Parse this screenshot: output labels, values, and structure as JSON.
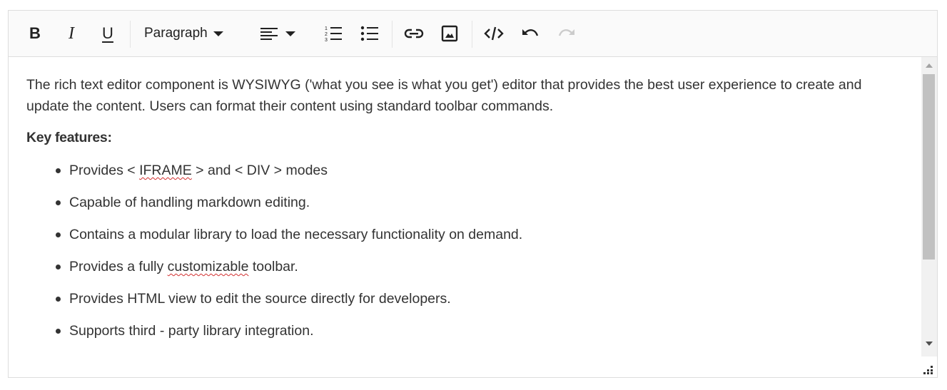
{
  "toolbar": {
    "bold_glyph": "B",
    "italic_glyph": "I",
    "underline_glyph": "U",
    "format_label": "Paragraph",
    "icons": [
      "bold-icon",
      "italic-icon",
      "underline-icon",
      "format-dropdown",
      "align-icon",
      "numbered-list-icon",
      "bulleted-list-icon",
      "link-icon",
      "image-icon",
      "source-code-icon",
      "undo-icon",
      "redo-icon"
    ],
    "redo_enabled": false
  },
  "content": {
    "intro": "The rich text editor component is WYSIWYG ('what you see is what you get') editor that provides the best user experience to create and update the content. Users can format their content using standard toolbar commands.",
    "key_features_heading": "Key features:",
    "features": [
      {
        "before": "Provides < ",
        "misspelled": "IFRAME",
        "after": " > and < DIV > modes"
      },
      {
        "before": "Capable of handling markdown editing.",
        "misspelled": "",
        "after": ""
      },
      {
        "before": "Contains a modular library to load the necessary functionality on demand.",
        "misspelled": "",
        "after": ""
      },
      {
        "before": "Provides a fully ",
        "misspelled": "customizable",
        "after": " toolbar."
      },
      {
        "before": "Provides HTML view to edit the source directly for developers.",
        "misspelled": "",
        "after": ""
      },
      {
        "before": "Supports third - party library integration.",
        "misspelled": "",
        "after": ""
      }
    ]
  },
  "colors": {
    "text": "#333333",
    "toolbar_bg": "#fafafa",
    "border": "#dddddd",
    "spellcheck": "#d32f2f",
    "scroll_thumb": "#c1c1c1"
  }
}
